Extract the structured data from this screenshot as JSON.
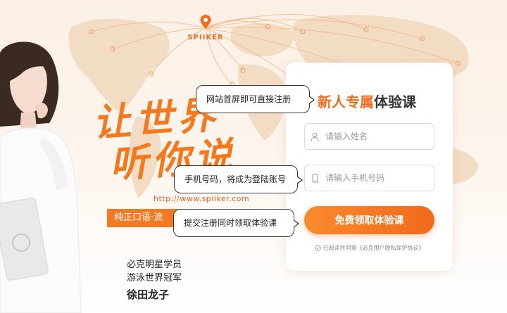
{
  "brand": {
    "logo_text": "SPIIKER",
    "slogan_line1": "让世界",
    "slogan_line2": "听你说",
    "url": "http://www.spiiker.com",
    "banner_text": "纯正口语·流"
  },
  "caption": {
    "line1": "必克明星学员",
    "line2": "游泳世界冠军",
    "name": "徐田龙子"
  },
  "form": {
    "title_highlight": "新人专属",
    "title_rest": "体验课",
    "name_placeholder": "请输入姓名",
    "phone_placeholder": "请输入手机号码",
    "submit_label": "免费领取体验课",
    "agreement": "已阅读并同意《必克用户隐私保护协议》"
  },
  "tooltips": {
    "tip1": "网站首屏即可直接注册",
    "tip2": "手机号码，将成为登陆账号",
    "tip3": "提交注册同时领取体验课"
  },
  "colors": {
    "accent": "#f26b1d",
    "banner": "#f27a24",
    "map": "#f3dcc4"
  }
}
